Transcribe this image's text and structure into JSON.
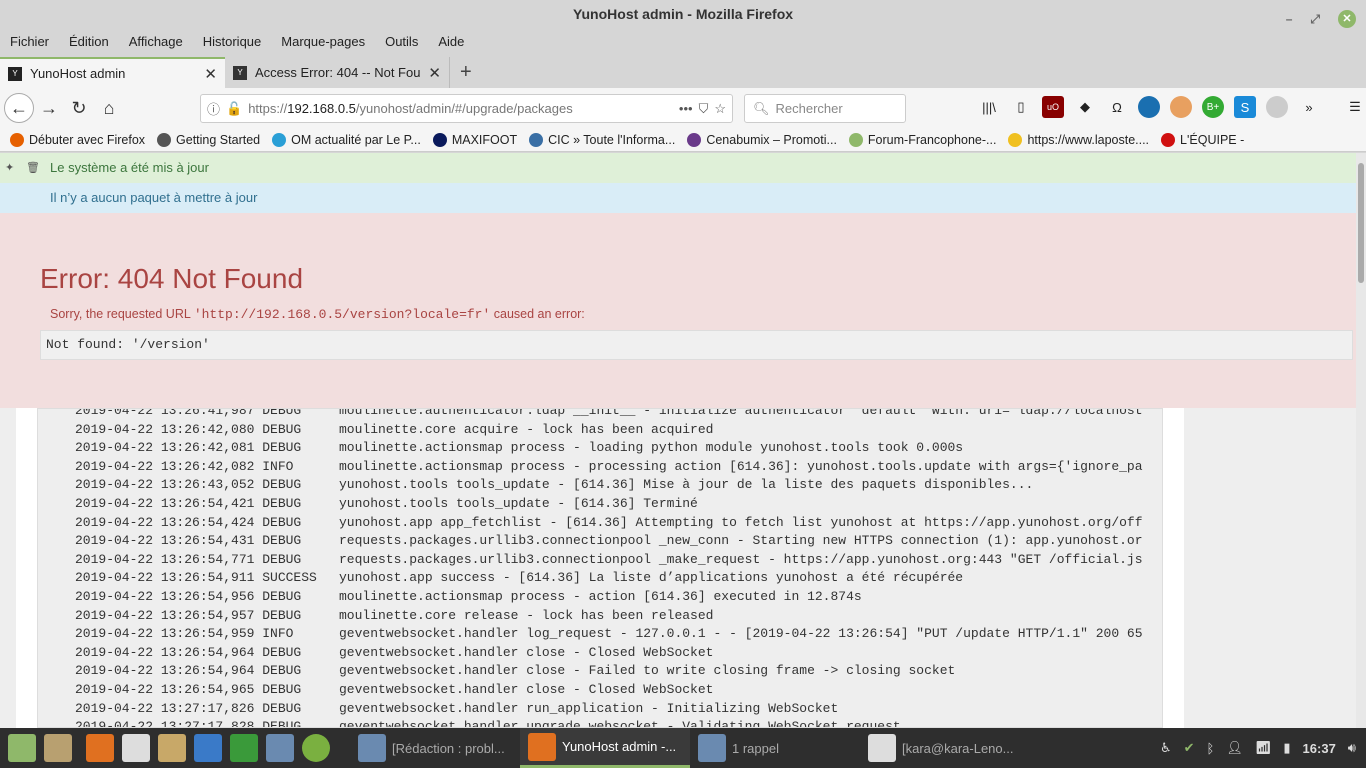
{
  "window": {
    "title": "YunoHost admin - Mozilla Firefox"
  },
  "menu": [
    "Fichier",
    "Édition",
    "Affichage",
    "Historique",
    "Marque-pages",
    "Outils",
    "Aide"
  ],
  "tabs": [
    {
      "label": "YunoHost admin"
    },
    {
      "label": "Access Error: 404 -- Not Found"
    }
  ],
  "nav": {
    "url_prefix": "https://",
    "url_host": "192.168.0.5",
    "url_path": "/yunohost/admin/#/upgrade/packages",
    "search_placeholder": "Rechercher"
  },
  "bookmarks": [
    {
      "label": "Débuter avec Firefox",
      "color": "#e66000"
    },
    {
      "label": "Getting Started",
      "color": "#555"
    },
    {
      "label": "OM actualité par Le P...",
      "color": "#2a9fd6"
    },
    {
      "label": "MAXIFOOT",
      "color": "#0a1a5c"
    },
    {
      "label": "CIC » Toute l'Informa...",
      "color": "#3a6fa5"
    },
    {
      "label": "Cenabumix – Promoti...",
      "color": "#6a3a8a"
    },
    {
      "label": "Forum-Francophone-...",
      "color": "#8fb86a"
    },
    {
      "label": "https://www.laposte....",
      "color": "#f0c020"
    },
    {
      "label": "L'ÉQUIPE -",
      "color": "#d01010"
    }
  ],
  "alerts": {
    "success": "Le système a été mis à jour",
    "info": "Il n’y a aucun paquet à mettre à jour"
  },
  "error": {
    "title": "Error: 404 Not Found",
    "msg_before": "Sorry, the requested URL ",
    "url": "'http://192.168.0.5/version?locale=fr'",
    "msg_after": " caused an error:",
    "detail": "Not found: '/version'"
  },
  "log": [
    {
      "ts": "2019-04-22 13:26:41,987 DEBUG",
      "msg": "moulinette.authenticator.ldap __init__ - initialize authenticator 'default' with: uri='ldap://localhost"
    },
    {
      "ts": "2019-04-22 13:26:42,080 DEBUG",
      "msg": "moulinette.core acquire - lock has been acquired"
    },
    {
      "ts": "2019-04-22 13:26:42,081 DEBUG",
      "msg": "moulinette.actionsmap process - loading python module yunohost.tools took 0.000s"
    },
    {
      "ts": "2019-04-22 13:26:42,082 INFO",
      "msg": "moulinette.actionsmap process - processing action [614.36]: yunohost.tools.update with args={'ignore_pa"
    },
    {
      "ts": "2019-04-22 13:26:43,052 DEBUG",
      "msg": "yunohost.tools tools_update - [614.36] Mise à jour de la liste des paquets disponibles..."
    },
    {
      "ts": "2019-04-22 13:26:54,421 DEBUG",
      "msg": "yunohost.tools tools_update - [614.36] Terminé"
    },
    {
      "ts": "2019-04-22 13:26:54,424 DEBUG",
      "msg": "yunohost.app app_fetchlist - [614.36] Attempting to fetch list yunohost at https://app.yunohost.org/off"
    },
    {
      "ts": "2019-04-22 13:26:54,431 DEBUG",
      "msg": "requests.packages.urllib3.connectionpool _new_conn - Starting new HTTPS connection (1): app.yunohost.or"
    },
    {
      "ts": "2019-04-22 13:26:54,771 DEBUG",
      "msg": "requests.packages.urllib3.connectionpool _make_request - https://app.yunohost.org:443 \"GET /official.js"
    },
    {
      "ts": "2019-04-22 13:26:54,911 SUCCESS",
      "msg": "yunohost.app success - [614.36] La liste d’applications yunohost a été récupérée"
    },
    {
      "ts": "2019-04-22 13:26:54,956 DEBUG",
      "msg": "moulinette.actionsmap process - action [614.36] executed in 12.874s"
    },
    {
      "ts": "2019-04-22 13:26:54,957 DEBUG",
      "msg": "moulinette.core release - lock has been released"
    },
    {
      "ts": "2019-04-22 13:26:54,959 INFO",
      "msg": "geventwebsocket.handler log_request - 127.0.0.1 - - [2019-04-22 13:26:54] \"PUT /update HTTP/1.1\" 200 65"
    },
    {
      "ts": "2019-04-22 13:26:54,964 DEBUG",
      "msg": "geventwebsocket.handler close - Closed WebSocket"
    },
    {
      "ts": "2019-04-22 13:26:54,964 DEBUG",
      "msg": "geventwebsocket.handler close - Failed to write closing frame -> closing socket"
    },
    {
      "ts": "2019-04-22 13:26:54,965 DEBUG",
      "msg": "geventwebsocket.handler close - Closed WebSocket"
    },
    {
      "ts": "2019-04-22 13:27:17,826 DEBUG",
      "msg": "geventwebsocket.handler run_application - Initializing WebSocket"
    },
    {
      "ts": "2019-04-22 13:27:17,828 DEBUG",
      "msg": "geventwebsocket.handler upgrade_websocket - Validating WebSocket request"
    }
  ],
  "taskbar": {
    "windows": [
      {
        "label": "[Rédaction : probl..."
      },
      {
        "label": "YunoHost admin -..."
      },
      {
        "label": "1 rappel"
      },
      {
        "label": "[kara@kara-Leno..."
      }
    ],
    "clock": "16:37"
  }
}
